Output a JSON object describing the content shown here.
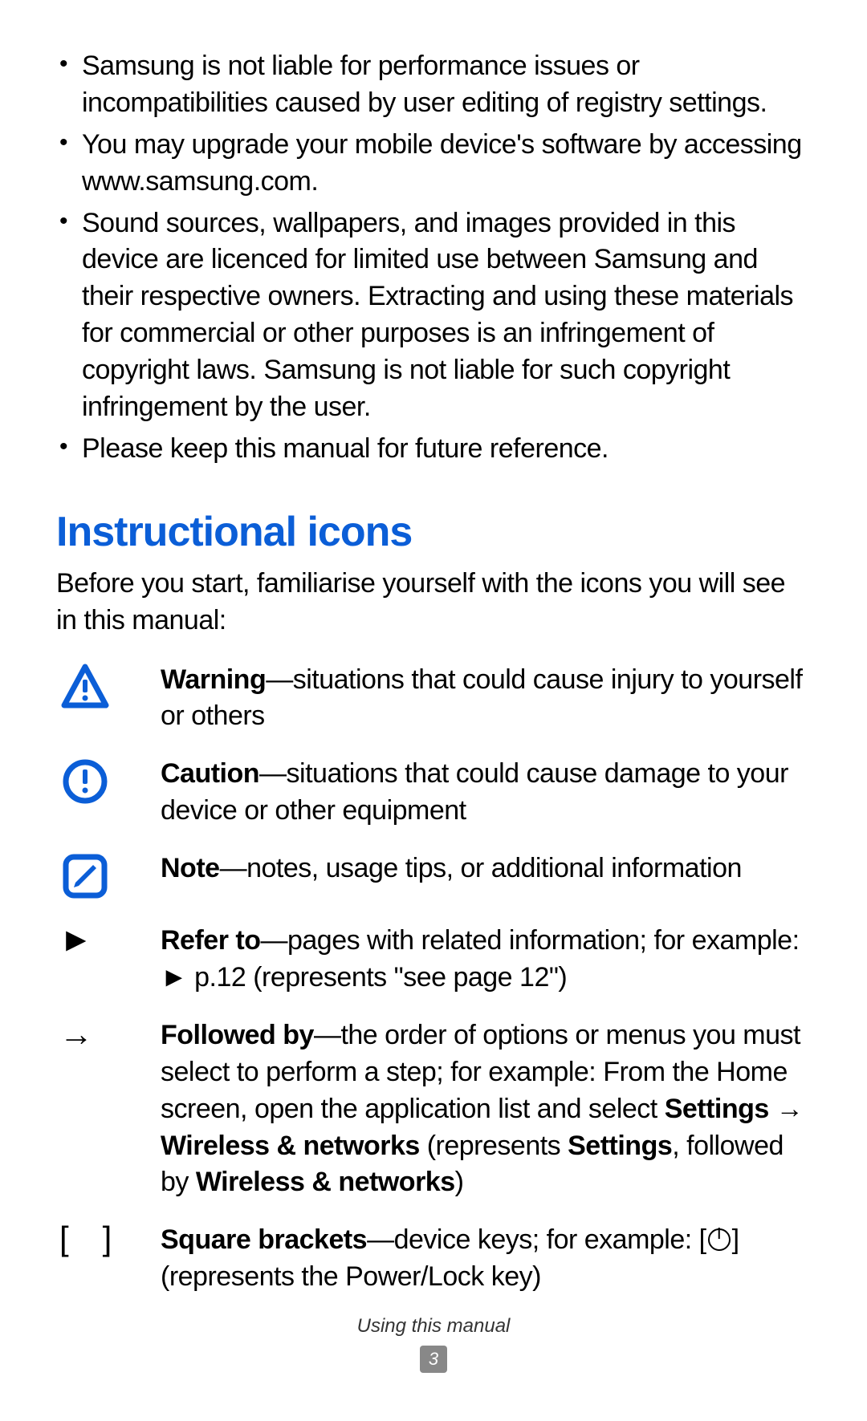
{
  "bullets": [
    "Samsung is not liable for performance issues or incompatibilities caused by user editing of registry settings.",
    "You may upgrade your mobile device's software by accessing www.samsung.com.",
    "Sound sources, wallpapers, and images provided in this device are licenced for limited use between Samsung and their respective owners. Extracting and using these materials for commercial or other purposes is an infringement of copyright laws. Samsung is not liable for such copyright infringement by the user.",
    "Please keep this manual for future reference."
  ],
  "heading": "Instructional icons",
  "intro": "Before you start, familiarise yourself with the icons you will see in this manual:",
  "icons": {
    "warning": {
      "term": "Warning",
      "desc": "—situations that could cause injury to yourself or others"
    },
    "caution": {
      "term": "Caution",
      "desc": "—situations that could cause damage to your device or other equipment"
    },
    "note": {
      "term": "Note",
      "desc": "—notes, usage tips, or additional information"
    },
    "refer": {
      "symbol": "►",
      "term": "Refer to",
      "desc": "—pages with related information; for example: ► p.12 (represents \"see page 12\")"
    },
    "followed": {
      "symbol": "→",
      "term": "Followed by",
      "desc_pre": "—the order of options or menus you must select to perform a step; for example: From the Home screen, open the application list and select ",
      "bold1": "Settings → Wireless & networks",
      "mid": " (represents ",
      "bold2": "Settings",
      "mid2": ", followed by ",
      "bold3": "Wireless & networks",
      "end": ")"
    },
    "brackets": {
      "symbol": "[ ]",
      "term": "Square brackets",
      "desc_pre": "—device keys; for example: [",
      "desc_post": "] (represents the Power/Lock key)"
    }
  },
  "footer": {
    "text": "Using this manual",
    "page": "3"
  }
}
